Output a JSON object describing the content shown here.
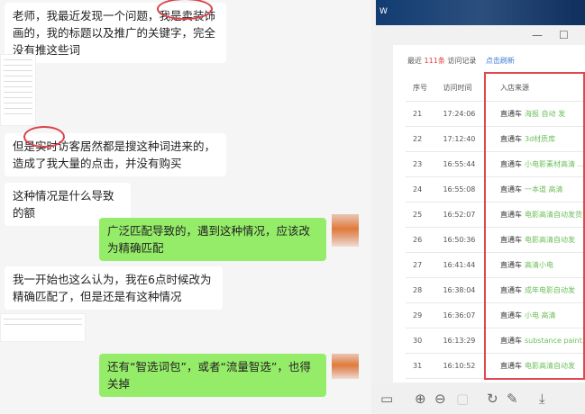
{
  "chat": {
    "messages": [
      {
        "side": "left",
        "text": "老师，我最近发现一个问题，我是卖装饰画的，我的标题以及推广的关键字，完全没有推这些词"
      },
      {
        "side": "left",
        "text": "但是实时访客居然都是搜这种词进来的，造成了我大量的点击，并没有购买"
      },
      {
        "side": "left",
        "text": "这种情况是什么导致的额"
      },
      {
        "side": "right",
        "text": "广泛匹配导致的，遇到这种情况，应该改为精确匹配"
      },
      {
        "side": "left",
        "text": "我一开始也这么认为，我在6点时候改为精确匹配了，但是还是有这种情况"
      },
      {
        "side": "right",
        "text": "还有“智选词包”，或者“流量智选”，也得关掉"
      }
    ]
  },
  "viewer": {
    "window_controls": {
      "minimize": "—",
      "maximize": "☐"
    },
    "summary": {
      "prefix": "最近",
      "count": "111条",
      "suffix": "访问记录",
      "refresh": "点击刷新"
    },
    "headers": [
      "序号",
      "访问时间",
      "入店来源"
    ],
    "rows": [
      {
        "n": "21",
        "time": "17:24:06",
        "channel": "直通车",
        "kw": "海报 自动 发"
      },
      {
        "n": "22",
        "time": "17:12:40",
        "channel": "直通车",
        "kw": "3d材质库"
      },
      {
        "n": "23",
        "time": "16:55:44",
        "channel": "直通车",
        "kw": "小电影素材高清 ..."
      },
      {
        "n": "24",
        "time": "16:55:08",
        "channel": "直通车",
        "kw": "一本道 高清"
      },
      {
        "n": "25",
        "time": "16:52:07",
        "channel": "直通车",
        "kw": "电影高清自动发货"
      },
      {
        "n": "26",
        "time": "16:50:36",
        "channel": "直通车",
        "kw": "电影高清自动发"
      },
      {
        "n": "27",
        "time": "16:41:44",
        "channel": "直通车",
        "kw": "高清小电"
      },
      {
        "n": "28",
        "time": "16:38:04",
        "channel": "直通车",
        "kw": "成年电影自动发"
      },
      {
        "n": "29",
        "time": "16:36:07",
        "channel": "直通车",
        "kw": "小电 高清"
      },
      {
        "n": "30",
        "time": "16:13:29",
        "channel": "直通车",
        "kw": "substance paint..."
      },
      {
        "n": "31",
        "time": "16:10:52",
        "channel": "直通车",
        "kw": "电影高清自动发"
      }
    ],
    "accent_red": "#e0484f"
  }
}
